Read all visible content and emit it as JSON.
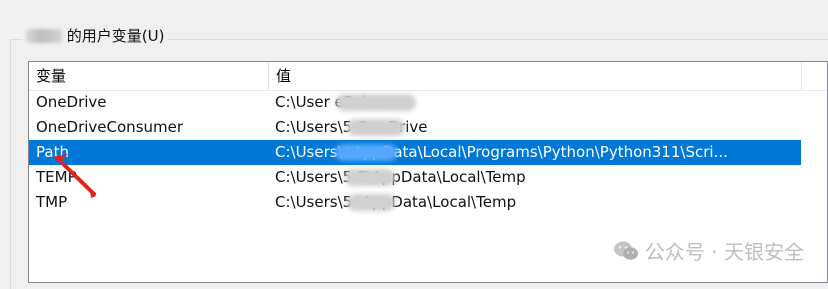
{
  "group": {
    "title_suffix": "的用户变量(U)"
  },
  "list": {
    "columns": [
      "变量",
      "值"
    ],
    "rows": [
      {
        "name": "OneDrive",
        "value": "C:\\User                          eDrive"
      },
      {
        "name": "OneDriveConsumer",
        "value": "C:\\Users\\5           OneDrive"
      },
      {
        "name": "Path",
        "value": "C:\\Users\\              \\AppData\\Local\\Programs\\Python\\Python311\\Scri...",
        "selected": true
      },
      {
        "name": "TEMP",
        "value": "C:\\Users\\5       7\\AppData\\Local\\Temp"
      },
      {
        "name": "TMP",
        "value": "C:\\Users\\5          \\AppData\\Local\\Temp"
      }
    ]
  },
  "watermark": {
    "text": "公众号 · 天银安全",
    "icon": "wechat-icon"
  },
  "annotation": {
    "icon": "red-arrow-icon",
    "color": "#e0201b"
  },
  "colors": {
    "selection": "#0078d7"
  }
}
